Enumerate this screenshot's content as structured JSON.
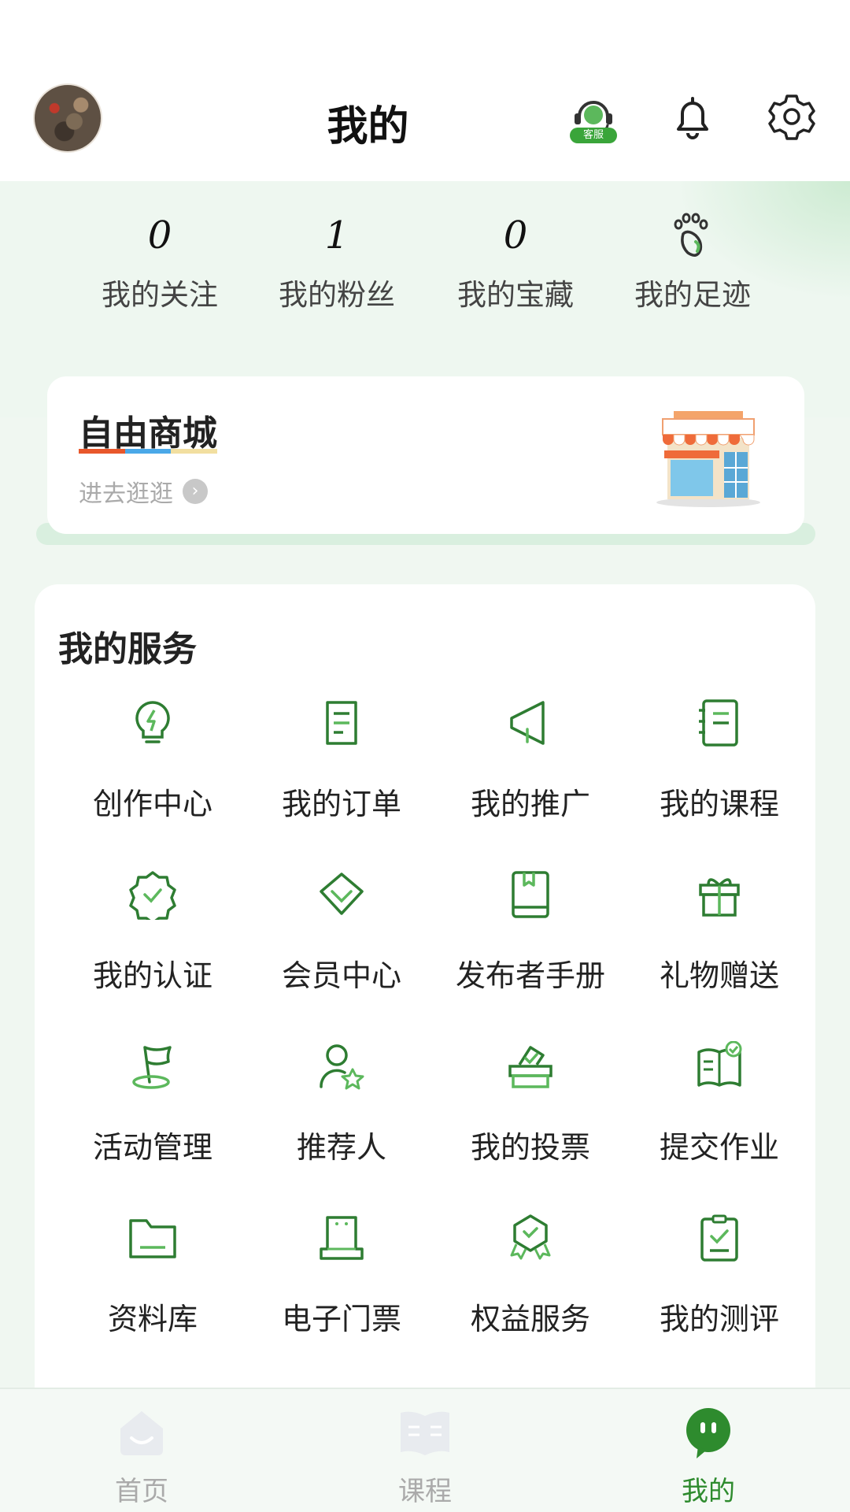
{
  "header": {
    "title": "我的",
    "support_badge": "客服",
    "avatar": "avatar",
    "icons": [
      "support-icon",
      "bell-icon",
      "gear-icon"
    ]
  },
  "stats": [
    {
      "value": "0",
      "label": "我的关注"
    },
    {
      "value": "1",
      "label": "我的粉丝"
    },
    {
      "value": "0",
      "label": "我的宝藏"
    },
    {
      "icon": "footprint-icon",
      "label": "我的足迹"
    }
  ],
  "mall": {
    "title": "自由商城",
    "subtitle": "进去逛逛",
    "underline_colors": [
      "#e8572b",
      "#4aa8e8",
      "#f2dfa0"
    ]
  },
  "services": {
    "title": "我的服务",
    "items": [
      {
        "label": "创作中心",
        "icon": "lightbulb-icon"
      },
      {
        "label": "我的订单",
        "icon": "order-icon"
      },
      {
        "label": "我的推广",
        "icon": "megaphone-icon"
      },
      {
        "label": "我的课程",
        "icon": "notebook-icon"
      },
      {
        "label": "我的认证",
        "icon": "verified-badge-icon"
      },
      {
        "label": "会员中心",
        "icon": "diamond-icon"
      },
      {
        "label": "发布者手册",
        "icon": "book-icon"
      },
      {
        "label": "礼物赠送",
        "icon": "gift-icon"
      },
      {
        "label": "活动管理",
        "icon": "flag-icon"
      },
      {
        "label": "推荐人",
        "icon": "person-star-icon"
      },
      {
        "label": "我的投票",
        "icon": "ballot-box-icon"
      },
      {
        "label": "提交作业",
        "icon": "homework-icon"
      },
      {
        "label": "资料库",
        "icon": "folder-icon"
      },
      {
        "label": "电子门票",
        "icon": "ticket-icon"
      },
      {
        "label": "权益服务",
        "icon": "shield-award-icon"
      },
      {
        "label": "我的测评",
        "icon": "clipboard-check-icon"
      }
    ]
  },
  "tabbar": {
    "tabs": [
      {
        "label": "首页",
        "icon": "home-icon",
        "active": false
      },
      {
        "label": "课程",
        "icon": "course-book-icon",
        "active": false
      },
      {
        "label": "我的",
        "icon": "profile-mascot-icon",
        "active": true
      }
    ]
  },
  "colors": {
    "accent": "#2e8b2e",
    "icon_green": "#2e7d32",
    "background": "#f0f7f1"
  }
}
